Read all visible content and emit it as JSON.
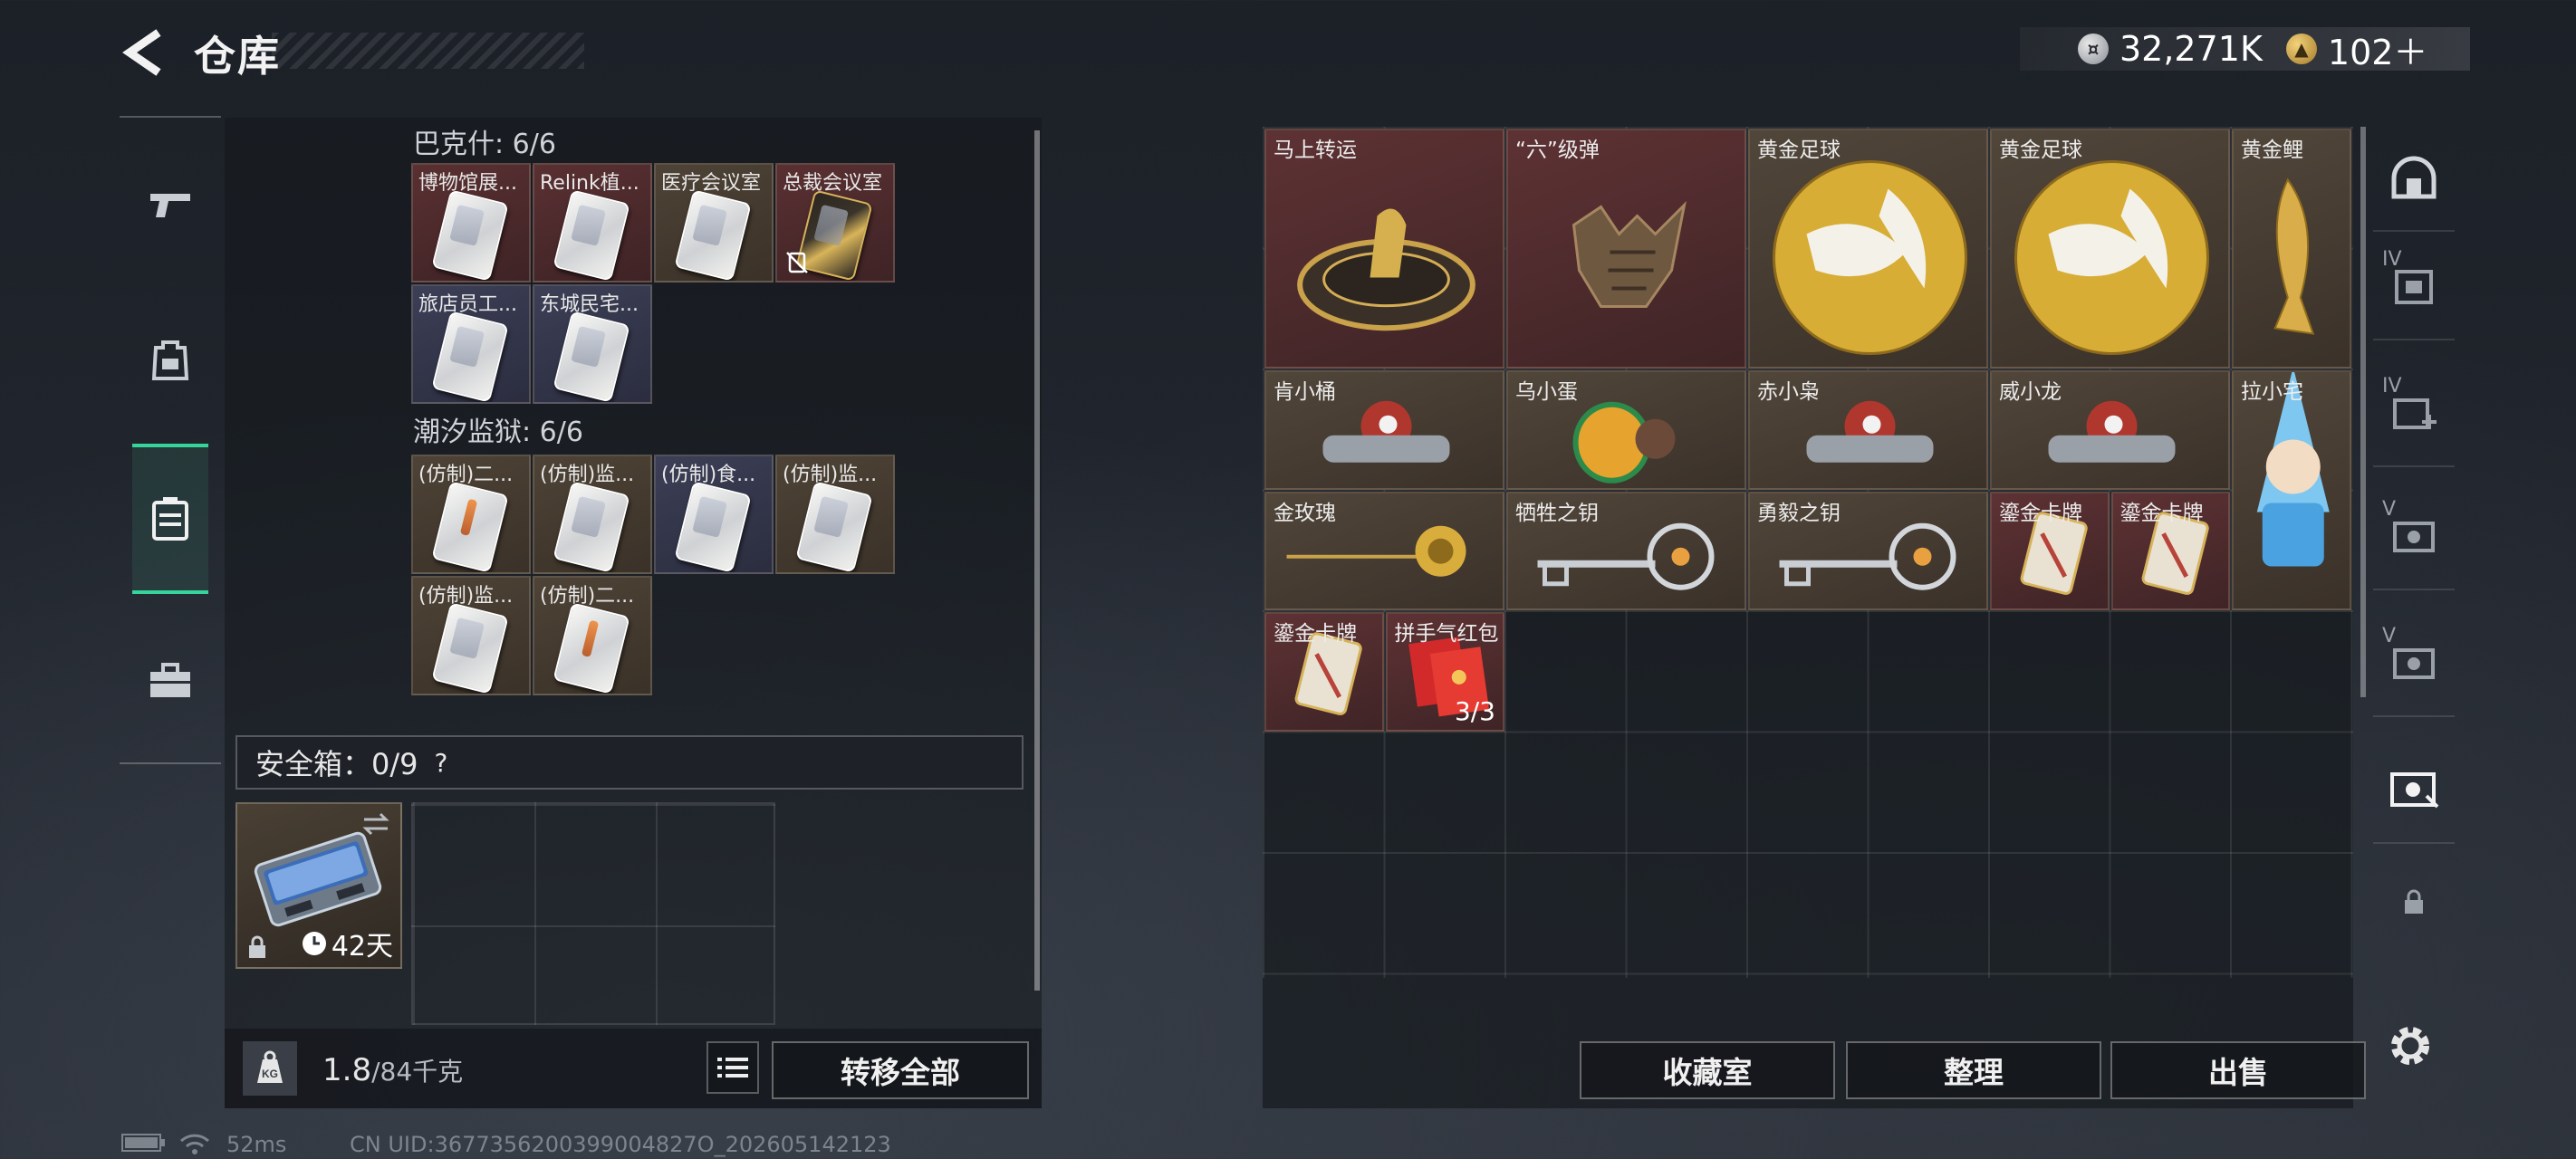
{
  "header": {
    "title": "仓库",
    "currency_coins": "32,271K",
    "currency_tokens": "102＋"
  },
  "nav": [
    {
      "name": "weapon-icon"
    },
    {
      "name": "backpack-icon"
    },
    {
      "name": "storage-icon",
      "active": true
    },
    {
      "name": "toolbox-icon"
    }
  ],
  "storage": {
    "section1_title": "巴克什: 6/6",
    "section1_items": [
      {
        "label": "博物馆展...",
        "rarity": "red"
      },
      {
        "label": "Relink植...",
        "rarity": "red"
      },
      {
        "label": "医疗会议室",
        "rarity": "brown"
      },
      {
        "label": "总裁会议室",
        "rarity": "red",
        "variant": "gold",
        "no_drop": true
      },
      {
        "label": "旅店员工...",
        "rarity": "blue"
      },
      {
        "label": "东城民宅...",
        "rarity": "blue"
      }
    ],
    "section2_title": "潮汐监狱: 6/6",
    "section2_items": [
      {
        "label": "(仿制)二...",
        "rarity": "brown",
        "variant": "orange"
      },
      {
        "label": "(仿制)监...",
        "rarity": "brown"
      },
      {
        "label": "(仿制)食...",
        "rarity": "blue"
      },
      {
        "label": "(仿制)监...",
        "rarity": "brown"
      },
      {
        "label": "(仿制)监...",
        "rarity": "brown"
      },
      {
        "label": "(仿制)二...",
        "rarity": "brown",
        "variant": "orange"
      }
    ],
    "safe_label": "安全箱：0/9",
    "safe_help": "?",
    "safebox_days": "42天",
    "weight_current": "1.8",
    "weight_max": "/84千克",
    "transfer_all": "转移全部"
  },
  "collection": {
    "items": [
      {
        "label": "马上转运",
        "rarity": "red",
        "icon": "horse-wheel"
      },
      {
        "label": "“六”级弹",
        "rarity": "red",
        "icon": "bronze-hand"
      },
      {
        "label": "黄金足球",
        "rarity": "brown",
        "icon": "gold-ball"
      },
      {
        "label": "黄金足球",
        "rarity": "brown",
        "icon": "gold-ball"
      },
      {
        "label": "黄金鲤",
        "rarity": "brown",
        "icon": "gold-carp"
      },
      {
        "label": "肯小桶",
        "rarity": "brown",
        "icon": "figure"
      },
      {
        "label": "乌小蛋",
        "rarity": "brown",
        "icon": "egg-figure"
      },
      {
        "label": "赤小枭",
        "rarity": "brown",
        "icon": "figure"
      },
      {
        "label": "威小龙",
        "rarity": "brown",
        "icon": "figure"
      },
      {
        "label": "拉小宅",
        "rarity": "brown",
        "icon": "figure-blue"
      },
      {
        "label": "金玫瑰",
        "rarity": "brown",
        "icon": "gold-rose"
      },
      {
        "label": "牺牲之钥",
        "rarity": "brown",
        "icon": "key"
      },
      {
        "label": "勇毅之钥",
        "rarity": "brown",
        "icon": "key"
      },
      {
        "label": "鎏金卡牌",
        "rarity": "red",
        "icon": "card"
      },
      {
        "label": "鎏金卡牌",
        "rarity": "red",
        "icon": "card"
      },
      {
        "label": "鎏金卡牌",
        "rarity": "red",
        "icon": "card"
      },
      {
        "label": "拼手气红包",
        "rarity": "red",
        "icon": "red-envelope",
        "count": "3/3"
      }
    ],
    "buttons": {
      "collection_room": "收藏室",
      "organize": "整理",
      "sell": "出售"
    }
  },
  "side_rail": [
    {
      "name": "home-icon",
      "tier": ""
    },
    {
      "name": "case-iv-icon",
      "tier": "IV"
    },
    {
      "name": "case-iv-plus-icon",
      "tier": "IV"
    },
    {
      "name": "case-v-icon",
      "tier": "V"
    },
    {
      "name": "case-v2-icon",
      "tier": "V"
    },
    {
      "name": "case-active-icon",
      "tier": ""
    },
    {
      "name": "lock-icon",
      "tier": ""
    }
  ],
  "status": {
    "ping": "52ms",
    "uid": "CN UID:3677356200399004827O_202605142123"
  },
  "colors": {
    "accent": "#36d39a",
    "rarity_red": "#5e3234",
    "rarity_brown": "#51463a",
    "rarity_blue": "#3c3f56"
  }
}
